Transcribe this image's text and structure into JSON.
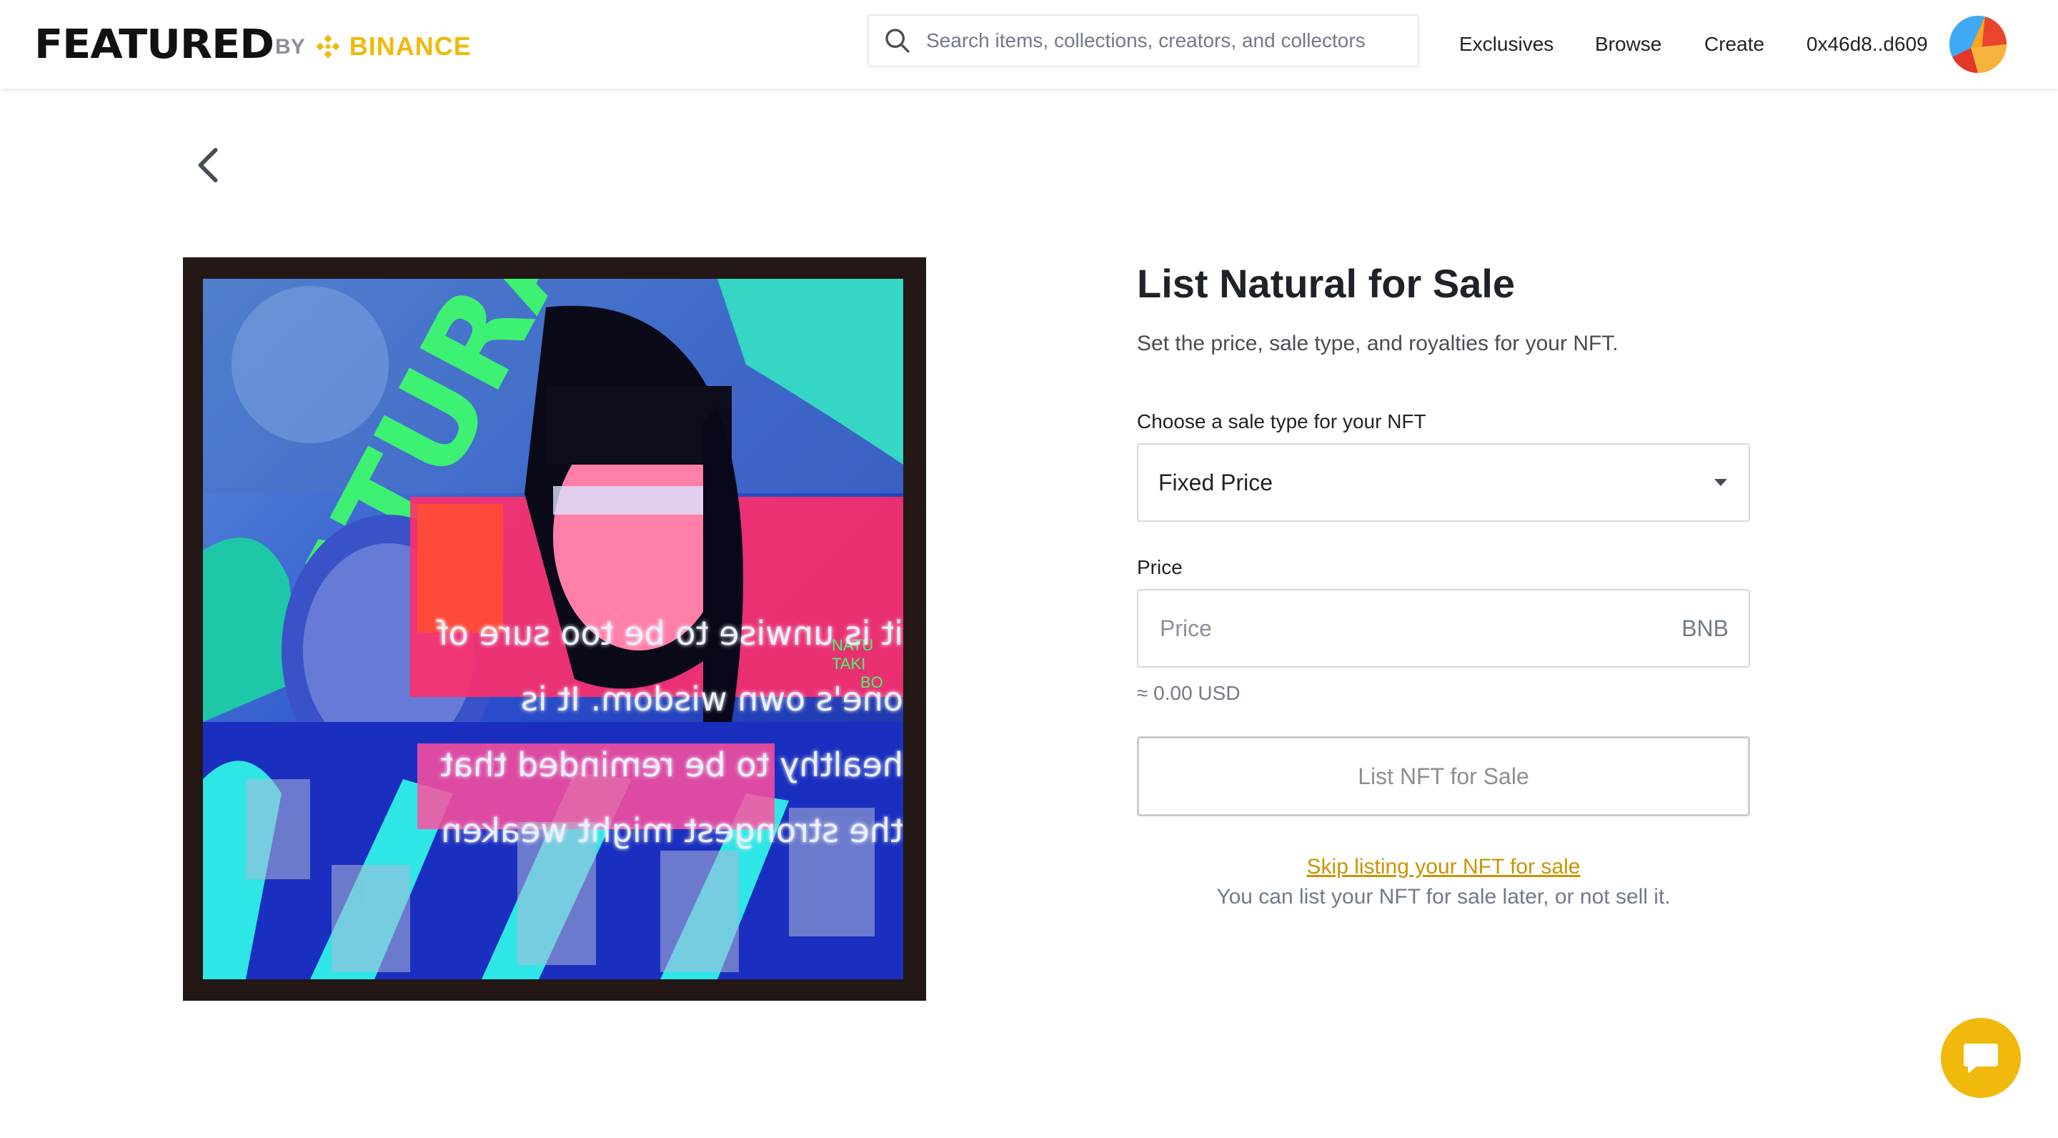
{
  "brand": {
    "featured": "FEATURED",
    "by": "BY",
    "binance": "BINANCE",
    "accent": "#f0b90b"
  },
  "search": {
    "placeholder": "Search items, collections, creators, and collectors",
    "icon": "search-icon"
  },
  "nav": {
    "exclusives": "Exclusives",
    "browse": "Browse",
    "create": "Create",
    "wallet": "0x46d8..d609"
  },
  "back": {
    "icon": "chevron-left-icon"
  },
  "artwork": {
    "overlay_text_lines": [
      "it is unwise to be too sure of",
      "one's own wisdom. It is",
      "healthy to be reminded that",
      "the strongest might weaken"
    ],
    "title_word": "NATURAL"
  },
  "form": {
    "title": "List Natural for Sale",
    "subtitle": "Set the price, sale type, and royalties for your NFT.",
    "sale_type_label": "Choose a sale type for your NFT",
    "sale_type_value": "Fixed Price",
    "price_label": "Price",
    "price_placeholder": "Price",
    "price_unit": "BNB",
    "usd_estimate": "≈ 0.00 USD",
    "submit_label": "List NFT for Sale",
    "skip_link": "Skip listing your NFT for sale",
    "skip_note": "You can list your NFT for sale later, or not sell it."
  },
  "chat": {
    "icon": "chat-icon"
  }
}
